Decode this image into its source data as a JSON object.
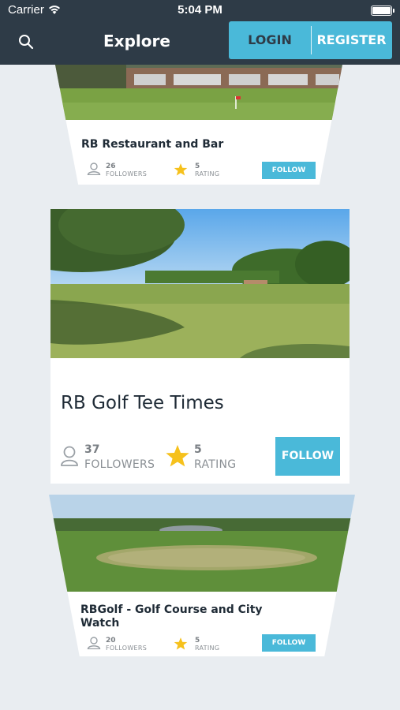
{
  "status_bar": {
    "carrier": "Carrier",
    "time": "5:04 PM"
  },
  "nav": {
    "title": "Explore",
    "login_label": "LOGIN",
    "register_label": "REGISTER"
  },
  "cards": [
    {
      "title": "RB Restaurant and Bar",
      "followers_count": "26",
      "followers_label": "FOLLOWERS",
      "rating_count": "5",
      "rating_label": "RATING",
      "follow_label": "FOLLOW"
    },
    {
      "title": "RB Golf Tee Times",
      "followers_count": "37",
      "followers_label": "FOLLOWERS",
      "rating_count": "5",
      "rating_label": "RATING",
      "follow_label": "FOLLOW"
    },
    {
      "title": "RBGolf - Golf Course and City Watch",
      "followers_count": "20",
      "followers_label": "FOLLOWERS",
      "rating_count": "5",
      "rating_label": "RATING",
      "follow_label": "FOLLOW"
    }
  ],
  "colors": {
    "nav_bg": "#2e3b47",
    "accent": "#4ab9d9",
    "star": "#f6c11c",
    "page_bg": "#e9edf1"
  },
  "icons": {
    "search": "search-icon",
    "wifi": "wifi-icon",
    "battery": "battery-icon",
    "person": "person-icon",
    "star": "star-icon"
  }
}
